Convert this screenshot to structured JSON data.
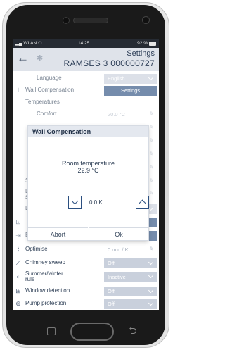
{
  "status_bar": {
    "network": "WLAN",
    "wifi_icon": "wifi-icon",
    "time": "14:25",
    "battery": "92 %"
  },
  "header": {
    "title": "Settings",
    "subtitle": "RAMSES 3  000000727",
    "back_icon": "back-arrow-icon",
    "bluetooth_icon": "bluetooth-icon"
  },
  "rows": {
    "language": {
      "label": "Language",
      "value": "English"
    },
    "wall_comp": {
      "label": "Wall Compensation",
      "value": "Settings"
    },
    "temperatures": {
      "label": "Temperatures"
    },
    "comfort": {
      "label": "Comfort",
      "value": "20.0 °C"
    },
    "r5": {
      "label": "S",
      "value": ""
    },
    "r6": {
      "label": "D",
      "label2": "s",
      "value": ""
    },
    "r7": {
      "label": "D",
      "value": ""
    },
    "r8": {
      "label": "",
      "value": ""
    },
    "r9": {
      "label": "E",
      "value": ""
    },
    "optimise": {
      "label": "Optimise",
      "value": "0 min / K"
    },
    "chimney": {
      "label": "Chimney sweep",
      "value": "Off"
    },
    "summer": {
      "label": "Summer/winter",
      "label2": "rule",
      "value": "Inactive"
    },
    "window": {
      "label": "Window detection",
      "value": "Off"
    },
    "pump": {
      "label": "Pump protection",
      "value": "Off"
    }
  },
  "dialog": {
    "title": "Wall Compensation",
    "label": "Room temperature",
    "temperature": "22.9 °C",
    "offset": "0.0 K",
    "abort": "Abort",
    "ok": "Ok"
  },
  "colors": {
    "primary": "#2b4f80",
    "header_bg": "#dfe3ea",
    "inactive_field": "#c9d0dc",
    "status_bar": "#262b33"
  }
}
